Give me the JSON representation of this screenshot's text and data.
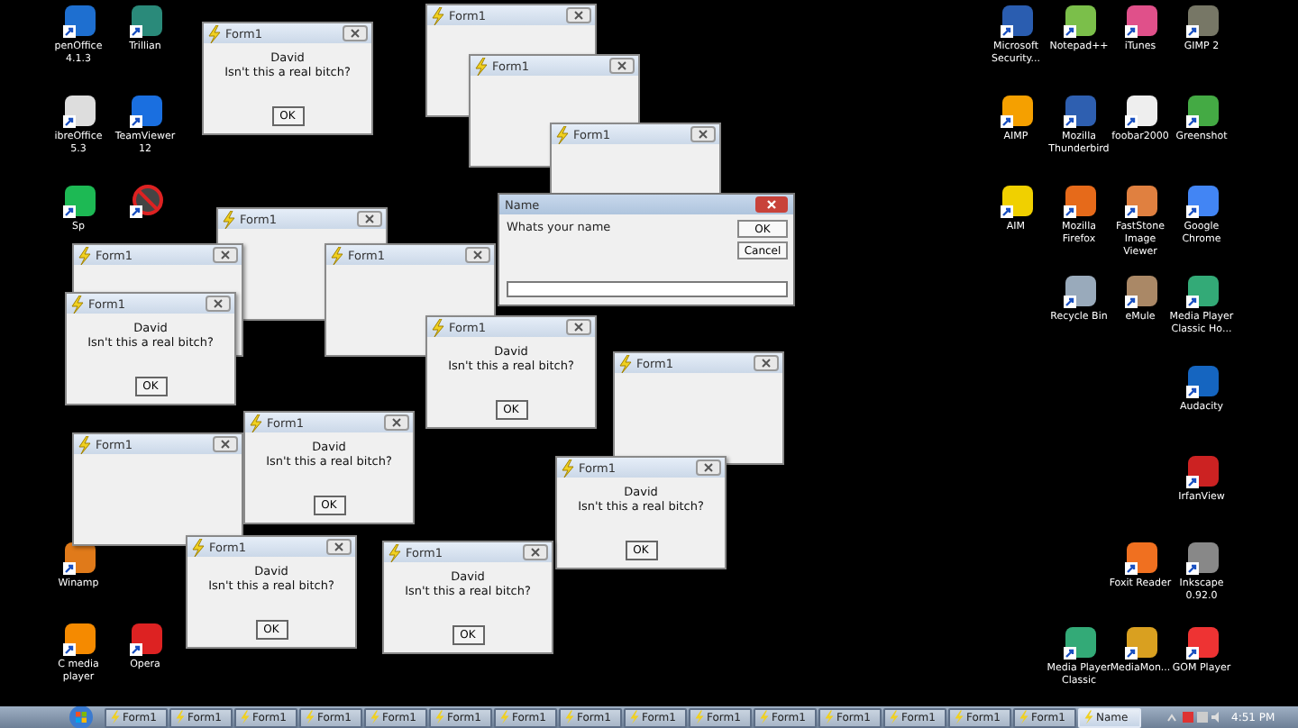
{
  "desktop_icons": [
    {
      "label": "penOffice 4.1.3"
    },
    {
      "label": "Trillian"
    },
    {
      "label": "ibreOffice 5.3"
    },
    {
      "label": "TeamViewer 12"
    },
    {
      "label": "Sp"
    },
    {
      "kind": "prohibition"
    },
    {
      "label": "Winamp"
    },
    {
      "label": "C media player"
    },
    {
      "label": "Opera"
    },
    {
      "label": "Microsoft Security..."
    },
    {
      "label": "Notepad++"
    },
    {
      "label": "iTunes"
    },
    {
      "label": "GIMP 2"
    },
    {
      "label": "AIMP"
    },
    {
      "label": "Mozilla Thunderbird"
    },
    {
      "label": "foobar2000"
    },
    {
      "label": "Greenshot"
    },
    {
      "label": "AIM"
    },
    {
      "label": "Mozilla Firefox"
    },
    {
      "label": "FastStone Image Viewer"
    },
    {
      "label": "Google Chrome"
    },
    {
      "label": "Recycle Bin"
    },
    {
      "label": "eMule"
    },
    {
      "label": "Media Player Classic Ho..."
    },
    {
      "label": "Audacity"
    },
    {
      "label": "IrfanView"
    },
    {
      "label": "Foxit Reader"
    },
    {
      "label": "Inkscape 0.92.0"
    },
    {
      "label": "Media Player Classic"
    },
    {
      "label": "MediaMon..."
    },
    {
      "label": "GOM Player"
    }
  ],
  "background_windows": [
    {
      "title": "Form1"
    },
    {
      "title": "Form1"
    },
    {
      "title": "Form1"
    },
    {
      "title": "Form1"
    },
    {
      "title": "Form1"
    },
    {
      "title": "Form1"
    },
    {
      "title": "Form1"
    },
    {
      "title": "Form1"
    }
  ],
  "message_boxes": [
    {
      "title": "Form1",
      "name": "David",
      "message": "Isn't this a real bitch?",
      "button": "OK"
    },
    {
      "title": "Form1",
      "name": "David",
      "message": "Isn't this a real bitch?",
      "button": "OK"
    },
    {
      "title": "Form1",
      "name": "David",
      "message": "Isn't this a real bitch?",
      "button": "OK"
    },
    {
      "title": "Form1",
      "name": "David",
      "message": "Isn't this a real bitch?",
      "button": "OK"
    },
    {
      "title": "Form1",
      "name": "David",
      "message": "Isn't this a real bitch?",
      "button": "OK"
    },
    {
      "title": "Form1",
      "name": "David",
      "message": "Isn't this a real bitch?",
      "button": "OK"
    },
    {
      "title": "Form1",
      "name": "David",
      "message": "Isn't this a real bitch?",
      "button": "OK"
    }
  ],
  "input_dialog": {
    "title": "Name",
    "prompt": "Whats your name",
    "buttons": [
      "OK",
      "Cancel"
    ]
  },
  "taskbar": {
    "buttons": [
      {
        "label": "Form1",
        "selected": false
      },
      {
        "label": "Form1",
        "selected": false
      },
      {
        "label": "Form1",
        "selected": false
      },
      {
        "label": "Form1",
        "selected": false
      },
      {
        "label": "Form1",
        "selected": false
      },
      {
        "label": "Form1",
        "selected": false
      },
      {
        "label": "Form1",
        "selected": false
      },
      {
        "label": "Form1",
        "selected": false
      },
      {
        "label": "Form1",
        "selected": false
      },
      {
        "label": "Form1",
        "selected": false
      },
      {
        "label": "Form1",
        "selected": false
      },
      {
        "label": "Form1",
        "selected": false
      },
      {
        "label": "Form1",
        "selected": false
      },
      {
        "label": "Form1",
        "selected": false
      },
      {
        "label": "Form1",
        "selected": false
      },
      {
        "label": "Name",
        "selected": true
      }
    ],
    "clock": "4:51 PM"
  }
}
